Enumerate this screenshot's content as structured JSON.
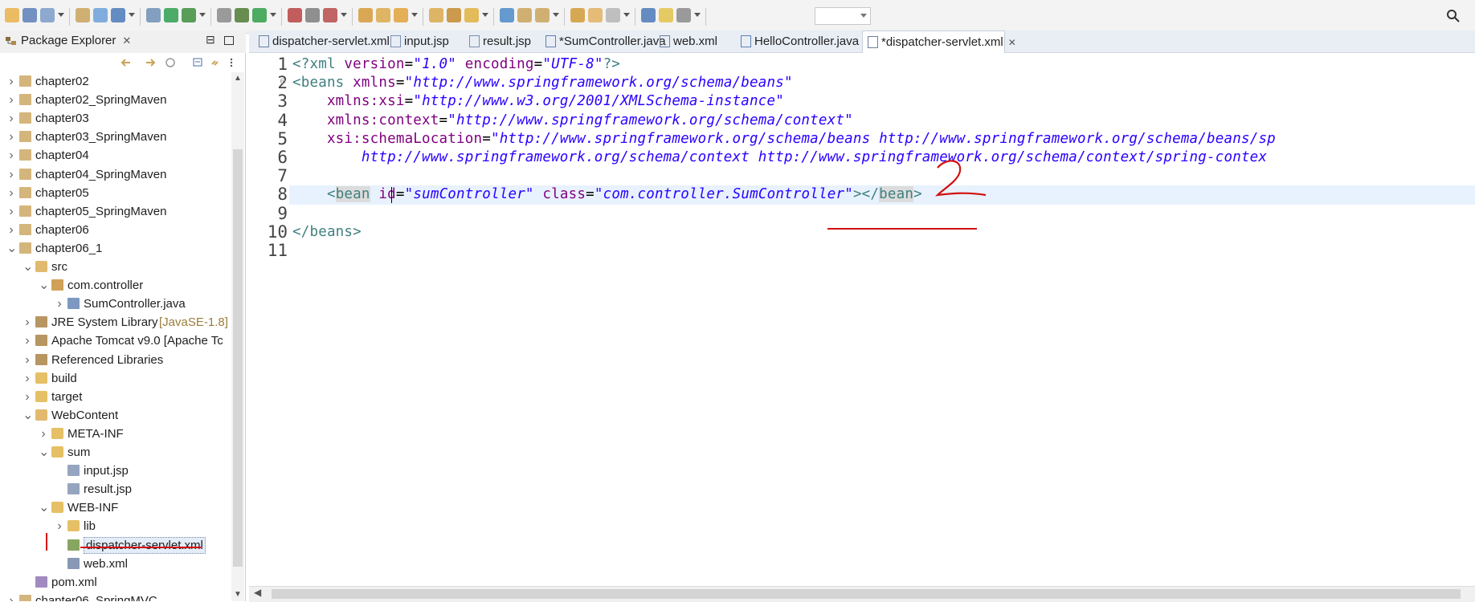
{
  "toolbar": {
    "icons": [
      "new-icon",
      "save-icon",
      "save-all-icon",
      "print-icon",
      "open-type-icon",
      "console-icon",
      "skip-breakpoints-icon",
      "spring-boot-icon",
      "refresh-icon",
      "build-icon",
      "debug-icon",
      "run-icon",
      "run-config-icon",
      "stop-icon",
      "external-tools-icon",
      "new-folder-icon",
      "new-project-icon",
      "new-java-class-icon",
      "open-folder-icon",
      "open-task-icon",
      "search-file-icon",
      "globe-icon",
      "next-annotation-icon",
      "prev-annotation-icon",
      "last-edit-icon",
      "back-icon",
      "forward-icon",
      "new-window-icon",
      "pin-icon",
      "perspectives-icon",
      "search-icon"
    ]
  },
  "explorer": {
    "title": "Package Explorer",
    "close_symbol": "✕",
    "minimize_symbol": "⊟",
    "tree": [
      {
        "label": "chapter02",
        "decor": "",
        "indent": 0,
        "expanded": false,
        "icon": "project-icon"
      },
      {
        "label": "chapter02_SpringMaven",
        "decor": "",
        "indent": 0,
        "expanded": false,
        "icon": "maven-project-icon"
      },
      {
        "label": "chapter03",
        "decor": "",
        "indent": 0,
        "expanded": false,
        "icon": "project-icon"
      },
      {
        "label": "chapter03_SpringMaven",
        "decor": "",
        "indent": 0,
        "expanded": false,
        "icon": "maven-project-icon"
      },
      {
        "label": "chapter04",
        "decor": "",
        "indent": 0,
        "expanded": false,
        "icon": "project-icon"
      },
      {
        "label": "chapter04_SpringMaven",
        "decor": "",
        "indent": 0,
        "expanded": false,
        "icon": "maven-project-icon"
      },
      {
        "label": "chapter05",
        "decor": "",
        "indent": 0,
        "expanded": false,
        "icon": "project-icon"
      },
      {
        "label": "chapter05_SpringMaven",
        "decor": "",
        "indent": 0,
        "expanded": false,
        "icon": "maven-project-icon"
      },
      {
        "label": "chapter06",
        "decor": "",
        "indent": 0,
        "expanded": false,
        "icon": "project-icon"
      },
      {
        "label": "chapter06_1",
        "decor": "",
        "indent": 0,
        "expanded": true,
        "icon": "maven-project-icon"
      },
      {
        "label": "src",
        "decor": "",
        "indent": 1,
        "expanded": true,
        "icon": "source-folder-icon"
      },
      {
        "label": "com.controller",
        "decor": "",
        "indent": 2,
        "expanded": true,
        "icon": "package-icon"
      },
      {
        "label": "SumController.java",
        "decor": "",
        "indent": 3,
        "expanded": false,
        "icon": "java-file-icon"
      },
      {
        "label": "JRE System Library",
        "decor": "[JavaSE-1.8]",
        "indent": 1,
        "expanded": false,
        "icon": "library-icon"
      },
      {
        "label": "Apache Tomcat v9.0 [Apache Tc",
        "decor": "",
        "indent": 1,
        "expanded": false,
        "icon": "library-icon"
      },
      {
        "label": "Referenced Libraries",
        "decor": "",
        "indent": 1,
        "expanded": false,
        "icon": "library-icon"
      },
      {
        "label": "build",
        "decor": "",
        "indent": 1,
        "expanded": false,
        "icon": "folder-icon"
      },
      {
        "label": "target",
        "decor": "",
        "indent": 1,
        "expanded": false,
        "icon": "folder-icon"
      },
      {
        "label": "WebContent",
        "decor": "",
        "indent": 1,
        "expanded": true,
        "icon": "web-folder-icon"
      },
      {
        "label": "META-INF",
        "decor": "",
        "indent": 2,
        "expanded": false,
        "icon": "folder-icon"
      },
      {
        "label": "sum",
        "decor": "",
        "indent": 2,
        "expanded": true,
        "icon": "folder-open-icon"
      },
      {
        "label": "input.jsp",
        "decor": "",
        "indent": 3,
        "expanded": null,
        "icon": "jsp-file-icon"
      },
      {
        "label": "result.jsp",
        "decor": "",
        "indent": 3,
        "expanded": null,
        "icon": "jsp-file-icon"
      },
      {
        "label": "WEB-INF",
        "decor": "",
        "indent": 2,
        "expanded": true,
        "icon": "folder-open-icon"
      },
      {
        "label": "lib",
        "decor": "",
        "indent": 3,
        "expanded": false,
        "icon": "folder-icon"
      },
      {
        "label": "dispatcher-servlet.xml",
        "decor": "",
        "indent": 3,
        "expanded": null,
        "icon": "spring-xml-file-icon",
        "selected": true
      },
      {
        "label": "web.xml",
        "decor": "",
        "indent": 3,
        "expanded": null,
        "icon": "xml-file-icon"
      },
      {
        "label": "pom.xml",
        "decor": "",
        "indent": 1,
        "expanded": null,
        "icon": "maven-pom-icon"
      },
      {
        "label": "chapter06_SpringMVC",
        "decor": "",
        "indent": 0,
        "expanded": false,
        "icon": "maven-project-icon"
      }
    ]
  },
  "tabs": [
    {
      "label": "dispatcher-servlet.xml",
      "icon": "xml-file-icon",
      "active": false
    },
    {
      "label": "input.jsp",
      "icon": "jsp-file-icon",
      "active": false
    },
    {
      "label": "result.jsp",
      "icon": "jsp-file-icon",
      "active": false
    },
    {
      "label": "*SumController.java",
      "icon": "java-file-icon",
      "active": false
    },
    {
      "label": "web.xml",
      "icon": "xml-file-icon",
      "active": false
    },
    {
      "label": "HelloController.java",
      "icon": "java-file-icon",
      "active": false
    },
    {
      "label": "*dispatcher-servlet.xml",
      "icon": "xml-file-icon",
      "active": true,
      "close": "✕"
    }
  ],
  "editor": {
    "line_numbers": [
      "1",
      "2",
      "3",
      "4",
      "5",
      "6",
      "7",
      "8",
      "9",
      "10",
      "11"
    ],
    "lines": [
      [
        {
          "t": "<?xml ",
          "c": "pi"
        },
        {
          "t": "version",
          "c": "attr"
        },
        {
          "t": "=",
          "c": "punct"
        },
        {
          "t": "\"1.0\"",
          "c": "str"
        },
        {
          "t": " ",
          "c": "punct"
        },
        {
          "t": "encoding",
          "c": "attr"
        },
        {
          "t": "=",
          "c": "punct"
        },
        {
          "t": "\"UTF-8\"",
          "c": "str"
        },
        {
          "t": "?>",
          "c": "pi"
        }
      ],
      [
        {
          "t": "<beans ",
          "c": "tag"
        },
        {
          "t": "xmlns",
          "c": "attr"
        },
        {
          "t": "=",
          "c": "punct"
        },
        {
          "t": "\"http://www.springframework.org/schema/beans\"",
          "c": "str"
        }
      ],
      [
        {
          "t": "    xmlns:xsi",
          "c": "attr"
        },
        {
          "t": "=",
          "c": "punct"
        },
        {
          "t": "\"http://www.w3.org/2001/XMLSchema-instance\"",
          "c": "str"
        }
      ],
      [
        {
          "t": "    xmlns:context",
          "c": "attr"
        },
        {
          "t": "=",
          "c": "punct"
        },
        {
          "t": "\"http://www.springframework.org/schema/context\"",
          "c": "str"
        }
      ],
      [
        {
          "t": "    xsi:schemaLocation",
          "c": "attr"
        },
        {
          "t": "=",
          "c": "punct"
        },
        {
          "t": "\"http://www.springframework.org/schema/beans http://www.springframework.org/schema/beans/sp",
          "c": "str"
        }
      ],
      [
        {
          "t": "        http://www.springframework.org/schema/context http://www.springframework.org/schema/context/spring-contex",
          "c": "str"
        }
      ],
      [],
      [
        {
          "t": "    <",
          "c": "tag"
        },
        {
          "t": "bean",
          "c": "tag-hl"
        },
        {
          "t": " ",
          "c": "punct"
        },
        {
          "t": "id",
          "c": "attr"
        },
        {
          "t": "=",
          "c": "punct"
        },
        {
          "t": "\"sumController\"",
          "c": "str"
        },
        {
          "t": " ",
          "c": "punct"
        },
        {
          "t": "class",
          "c": "attr"
        },
        {
          "t": "=",
          "c": "punct"
        },
        {
          "t": "\"com.controller.SumController\"",
          "c": "str"
        },
        {
          "t": "></",
          "c": "tag"
        },
        {
          "t": "bean",
          "c": "tag-hl"
        },
        {
          "t": ">",
          "c": "tag"
        }
      ],
      [],
      [
        {
          "t": "</beans>",
          "c": "tag"
        }
      ],
      []
    ],
    "annotation_mark": "2"
  },
  "colors": {
    "tag": "#3f7f7f",
    "attr": "#7f007f",
    "string": "#2a00ff",
    "annotation": "#d21010",
    "line_highlight": "#e8f2fe"
  }
}
